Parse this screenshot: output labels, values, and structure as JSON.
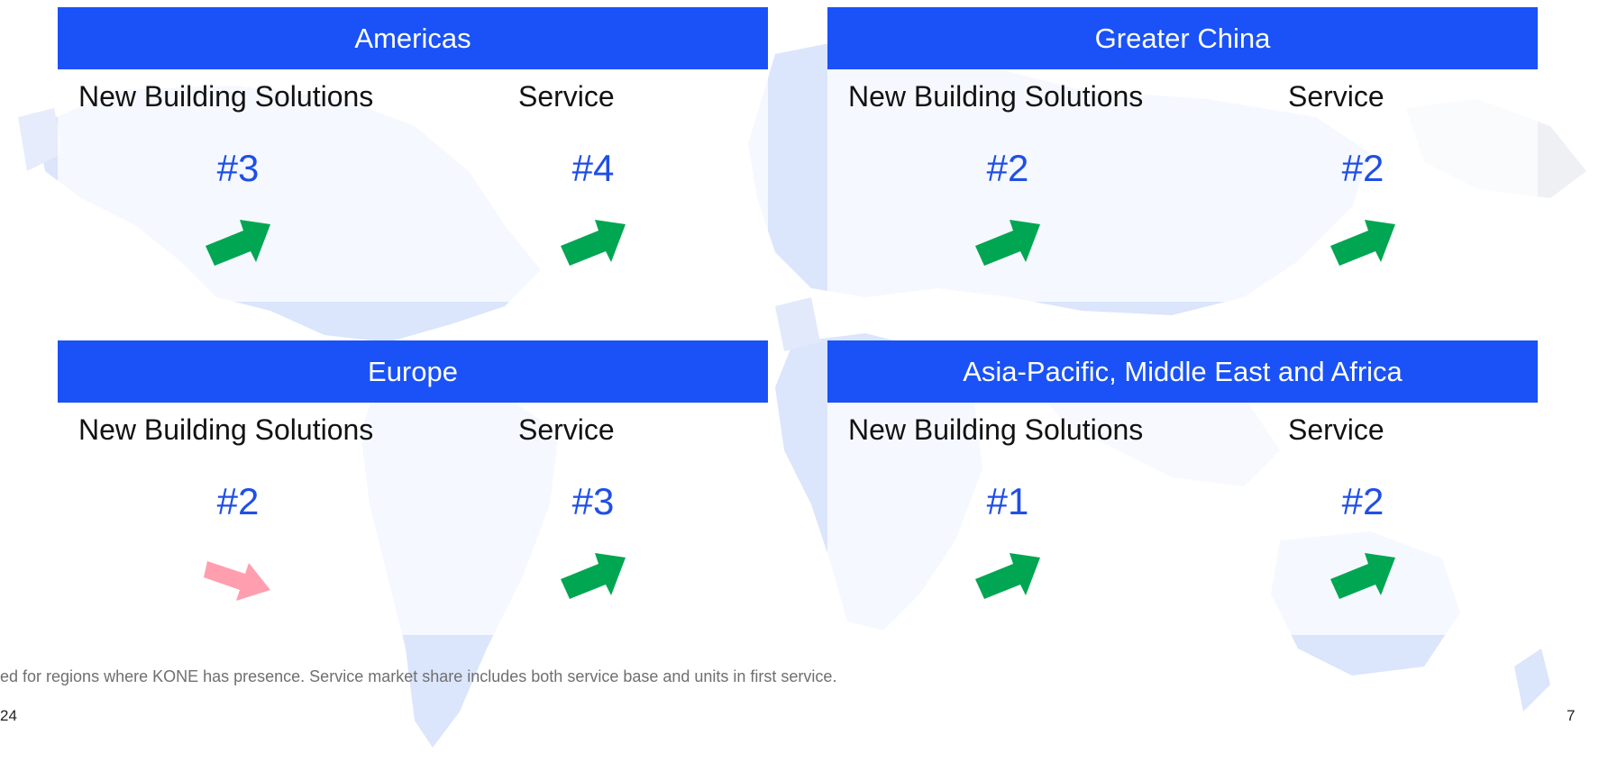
{
  "colors": {
    "header_bg": "#1a52f7",
    "rank_text": "#1f4fe6",
    "arrow_up": "#00a651",
    "arrow_down": "#ff9eaf",
    "map": "#dbe5fb"
  },
  "regions": [
    {
      "title": "Americas",
      "nbs": {
        "label": "New Building Solutions",
        "rank": "#3",
        "trend": "up",
        "icon": "trend-up-arrow-icon"
      },
      "service": {
        "label": "Service",
        "rank": "#4",
        "trend": "up",
        "icon": "trend-up-arrow-icon"
      }
    },
    {
      "title": "Greater China",
      "nbs": {
        "label": "New Building Solutions",
        "rank": "#2",
        "trend": "up",
        "icon": "trend-up-arrow-icon"
      },
      "service": {
        "label": "Service",
        "rank": "#2",
        "trend": "up",
        "icon": "trend-up-arrow-icon"
      }
    },
    {
      "title": "Europe",
      "nbs": {
        "label": "New Building Solutions",
        "rank": "#2",
        "trend": "down",
        "icon": "trend-down-arrow-icon"
      },
      "service": {
        "label": "Service",
        "rank": "#3",
        "trend": "up",
        "icon": "trend-up-arrow-icon"
      }
    },
    {
      "title": "Asia-Pacific, Middle East and Africa",
      "nbs": {
        "label": "New Building Solutions",
        "rank": "#1",
        "trend": "up",
        "icon": "trend-up-arrow-icon"
      },
      "service": {
        "label": "Service",
        "rank": "#2",
        "trend": "up",
        "icon": "trend-up-arrow-icon"
      }
    }
  ],
  "footnote": "ed for regions where KONE has presence. Service market share includes both service base and units in first service.",
  "footer_left": "24",
  "page_number": "7"
}
